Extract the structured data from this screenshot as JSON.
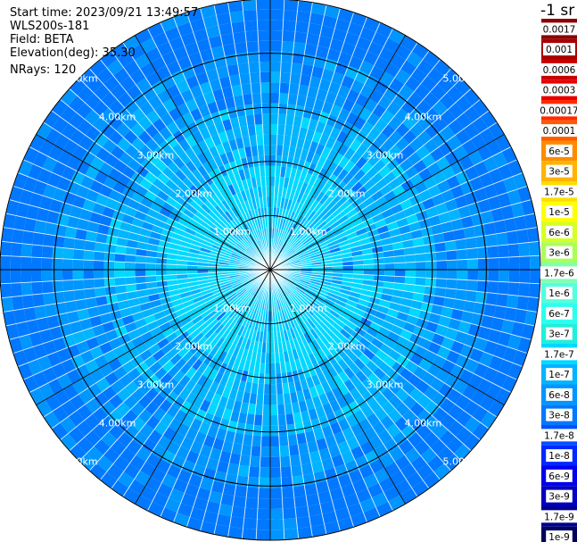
{
  "info": {
    "start_time": "Start time: 2023/09/21 13:49:57",
    "instrument": "WLS200s-181",
    "field": "Field: BETA",
    "elevation": "Elevation(deg): 35.30",
    "nrays": "NRays: 120"
  },
  "colorbar": {
    "title": "-1 sr",
    "labels": [
      "0.0017",
      "0.001",
      "0.0006",
      "0.0003",
      "0.00017",
      "0.0001",
      "6e-5",
      "3e-5",
      "1.7e-5",
      "1e-5",
      "6e-6",
      "3e-6",
      "1.7e-6",
      "1e-6",
      "6e-7",
      "3e-7",
      "1.7e-7",
      "1e-7",
      "6e-8",
      "3e-8",
      "1.7e-8",
      "1e-8",
      "6e-9",
      "3e-9",
      "1.7e-9",
      "1e-9"
    ],
    "colors": [
      "#8b0000",
      "#a80000",
      "#c80000",
      "#e60000",
      "#ff2a00",
      "#ff5a00",
      "#ff8c00",
      "#ffb400",
      "#ffdc00",
      "#ffff00",
      "#d6ff29",
      "#aaff55",
      "#7fffb0",
      "#55ffdd",
      "#2dffee",
      "#22eedd",
      "#00d8ff",
      "#00b4ff",
      "#0096ff",
      "#0078ff",
      "#0050ff",
      "#0028ff",
      "#0000ee",
      "#0000c0",
      "#000090",
      "#000060"
    ]
  },
  "chart_data": {
    "type": "heatmap",
    "projection": "polar (plan position indicator)",
    "n_rays": 120,
    "range_rings": [
      {
        "range_km": 1.0,
        "label": "1.00km"
      },
      {
        "range_km": 2.0,
        "label": "2.00km"
      },
      {
        "range_km": 3.0,
        "label": "3.00km"
      },
      {
        "range_km": 4.0,
        "label": "4.00km"
      },
      {
        "range_km": 5.0,
        "label": "5.00km"
      }
    ],
    "max_range_km": 5.0,
    "spokes_deg": [
      0,
      30,
      60,
      90,
      120,
      150,
      180,
      210,
      240,
      270,
      300,
      330
    ],
    "ring_label_bearings_deg": [
      315,
      45,
      135,
      225
    ],
    "approx_field_by_range_km": [
      {
        "range_km": 0.5,
        "beta": "1.7e-7"
      },
      {
        "range_km": 1.5,
        "beta": "1.7e-7"
      },
      {
        "range_km": 2.5,
        "beta": "1e-7"
      },
      {
        "range_km": 3.5,
        "beta": "6e-8"
      },
      {
        "range_km": 4.5,
        "beta": "3e-8"
      },
      {
        "range_km": 5.0,
        "beta": "3e-8"
      }
    ]
  }
}
